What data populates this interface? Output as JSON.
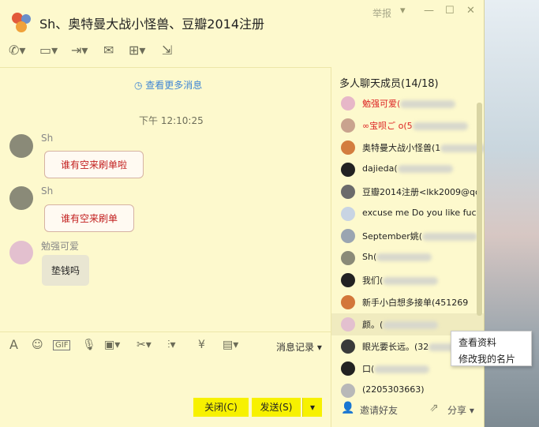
{
  "window": {
    "title": "Sh、奥特曼大战小怪兽、豆瓣2014注册",
    "report_label": "举报"
  },
  "chat": {
    "more_history": "查看更多消息",
    "timestamp": "下午 12:10:25",
    "messages": [
      {
        "sender": "Sh",
        "text": "谁有空来刷单啦"
      },
      {
        "sender": "Sh",
        "text": "谁有空来刷单"
      },
      {
        "sender": "勉强可爱",
        "text": "垫钱吗"
      }
    ]
  },
  "input": {
    "history_label": "消息记录",
    "close_label": "关闭(C)",
    "send_label": "发送(S)"
  },
  "members": {
    "header": "多人聊天成员(14/18)",
    "items": [
      {
        "name": "勉强可爱(",
        "red": true
      },
      {
        "name": "∞宝呗ご o(5",
        "red": true
      },
      {
        "name": "奥特曼大战小怪兽(1"
      },
      {
        "name": "dajieda("
      },
      {
        "name": "豆瓣2014注册<lkk2009@qq"
      },
      {
        "name": "excuse me Do you like fuck"
      },
      {
        "name": "September姚("
      },
      {
        "name": "Sh("
      },
      {
        "name": "我们("
      },
      {
        "name": "新手小白想多接单(451269"
      },
      {
        "name": "颜。("
      },
      {
        "name": "眼光要长远。(32"
      },
      {
        "name": "口("
      },
      {
        "name": "(2205303663)"
      }
    ],
    "invite_label": "邀请好友",
    "share_label": "分享"
  },
  "context_menu": {
    "items": [
      "查看资料",
      "修改我的名片"
    ]
  }
}
